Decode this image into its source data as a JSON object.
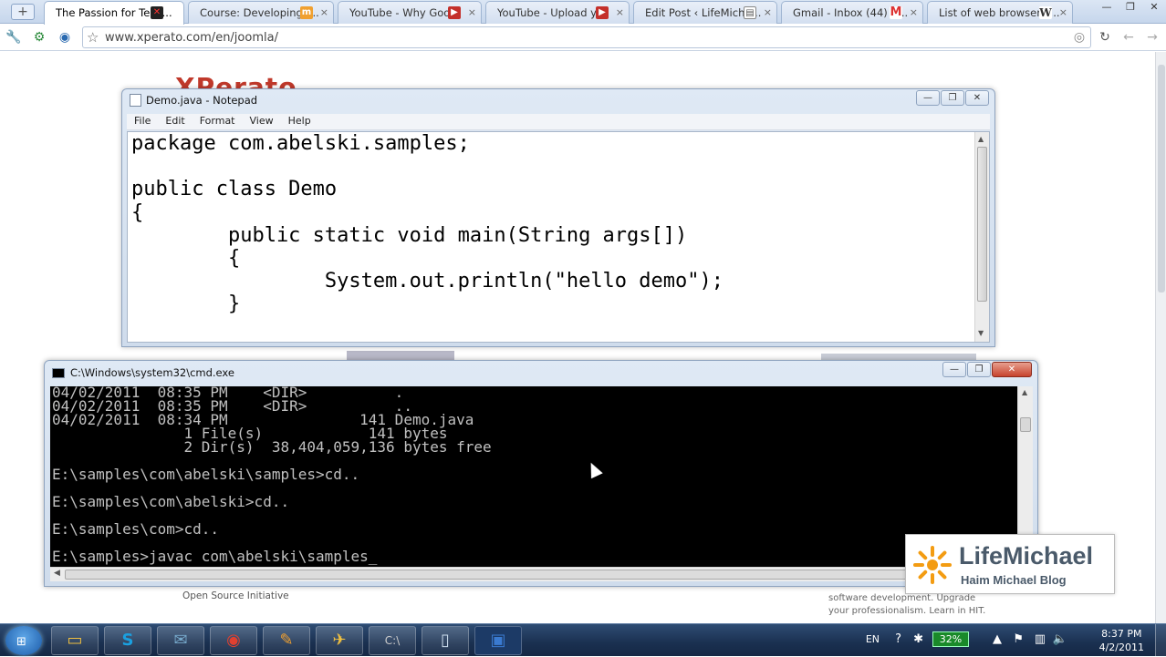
{
  "browser": {
    "tabs": [
      {
        "title": "The Passion for Teac...",
        "icon": "tab-favicon-xperato",
        "active": true
      },
      {
        "title": "Course: Developing J...",
        "icon": "tab-favicon-moodle"
      },
      {
        "title": "YouTube - Why Goo...",
        "icon": "tab-favicon-youtube"
      },
      {
        "title": "YouTube - Upload y...",
        "icon": "tab-favicon-youtube"
      },
      {
        "title": "Edit Post ‹ LifeMicha...",
        "icon": "tab-favicon-wordpress"
      },
      {
        "title": "Gmail - Inbox (44) - ...",
        "icon": "tab-favicon-gmail"
      },
      {
        "title": "List of web browsers ...",
        "icon": "tab-favicon-wikipedia"
      }
    ],
    "url": "www.xperato.com/en/joomla/"
  },
  "page": {
    "logo_text": "XPerato",
    "left_link": "Open Source Initiative",
    "promo_line1": "software development. Upgrade",
    "promo_line2": "your professionalism. Learn in HIT."
  },
  "notepad": {
    "title": "Demo.java - Notepad",
    "menu": [
      "File",
      "Edit",
      "Format",
      "View",
      "Help"
    ],
    "code": "package com.abelski.samples;\n\npublic class Demo\n{\n        public static void main(String args[])\n        {\n                System.out.println(\"hello demo\");\n        }"
  },
  "cmd": {
    "title": "C:\\Windows\\system32\\cmd.exe",
    "lines": "04/02/2011  08:35 PM    <DIR>          .\n04/02/2011  08:35 PM    <DIR>          ..\n04/02/2011  08:34 PM               141 Demo.java\n               1 File(s)            141 bytes\n               2 Dir(s)  38,404,059,136 bytes free\n\nE:\\samples\\com\\abelski\\samples>cd..\n\nE:\\samples\\com\\abelski>cd..\n\nE:\\samples\\com>cd..\n\nE:\\samples>javac com\\abelski\\samples_"
  },
  "watermark": {
    "name": "LifeMichael",
    "subtitle": "Haim Michael Blog"
  },
  "taskbar": {
    "language": "EN",
    "battery": "32%",
    "time": "8:37 PM",
    "date": "4/2/2011"
  }
}
